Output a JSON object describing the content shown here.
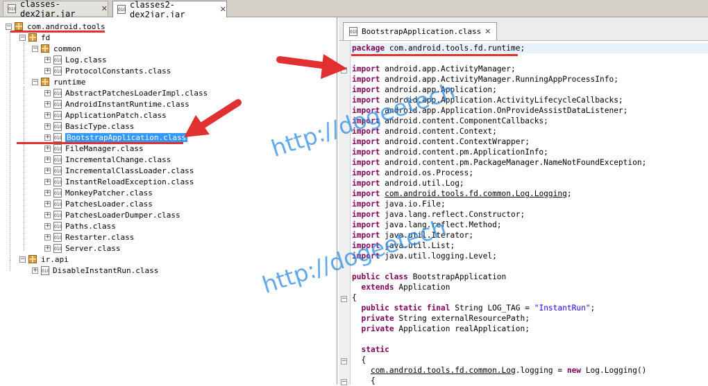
{
  "file_tabs": [
    {
      "label": "classes-dex2jar.jar",
      "active": false
    },
    {
      "label": "classes2-dex2jar.jar",
      "active": true
    }
  ],
  "tree": {
    "root": "com.android.tools",
    "fd": "fd",
    "common": "common",
    "common_items": [
      "Log.class",
      "ProtocolConstants.class"
    ],
    "runtime": "runtime",
    "runtime_items": [
      "AbstractPatchesLoaderImpl.class",
      "AndroidInstantRuntime.class",
      "ApplicationPatch.class",
      "BasicType.class",
      "BootstrapApplication.class",
      "FileManager.class",
      "IncrementalChange.class",
      "IncrementalClassLoader.class",
      "InstantReloadException.class",
      "MonkeyPatcher.class",
      "PatchesLoader.class",
      "PatchesLoaderDumper.class",
      "Paths.class",
      "Restarter.class",
      "Server.class"
    ],
    "selected": "BootstrapApplication.class",
    "irapi": "ir.api",
    "irapi_items": [
      "DisableInstantRun.class"
    ]
  },
  "editor": {
    "tab_label": "BootstrapApplication.class",
    "code": {
      "package_kw": "package",
      "package_name": " com.android.tools.fd.runtime;",
      "import_kw": "import",
      "imports": [
        " android.app.ActivityManager;",
        " android.app.ActivityManager.RunningAppProcessInfo;",
        " android.app.Application;",
        " android.app.Application.ActivityLifecycleCallbacks;",
        " android.app.Application.OnProvideAssistDataListener;",
        " android.content.ComponentCallbacks;",
        " android.content.Context;",
        " android.content.ContextWrapper;",
        " android.content.pm.ApplicationInfo;",
        " android.content.pm.PackageManager.NameNotFoundException;",
        " android.os.Process;",
        " android.util.Log;",
        "com.android.tools.fd.common.Log.Logging",
        " java.io.File;",
        " java.lang.reflect.Constructor;",
        " java.lang.reflect.Method;",
        " java.util.Iterator;",
        " java.util.List;",
        " java.util.logging.Level;"
      ],
      "class_kw": "public class",
      "class_name": " BootstrapApplication",
      "extends_kw": "extends",
      "extends_name": " Application",
      "open_brace": "{",
      "field1_kw": "public static final",
      "field1_rest": " String LOG_TAG = ",
      "field1_str": "\"InstantRun\"",
      "field1_end": ";",
      "field2_kw": "private",
      "field2_rest": " String externalResourcePath;",
      "field3_kw": "private",
      "field3_rest": " Application realApplication;",
      "static_kw": "static",
      "static_open": "{",
      "log_u1": "com.android.tools.fd.common.Log",
      "log_mid": ".logging = ",
      "log_new": "new",
      "log_end": " Log.Logging()",
      "last_brace": "{"
    }
  },
  "watermark": "http://dogeetech"
}
